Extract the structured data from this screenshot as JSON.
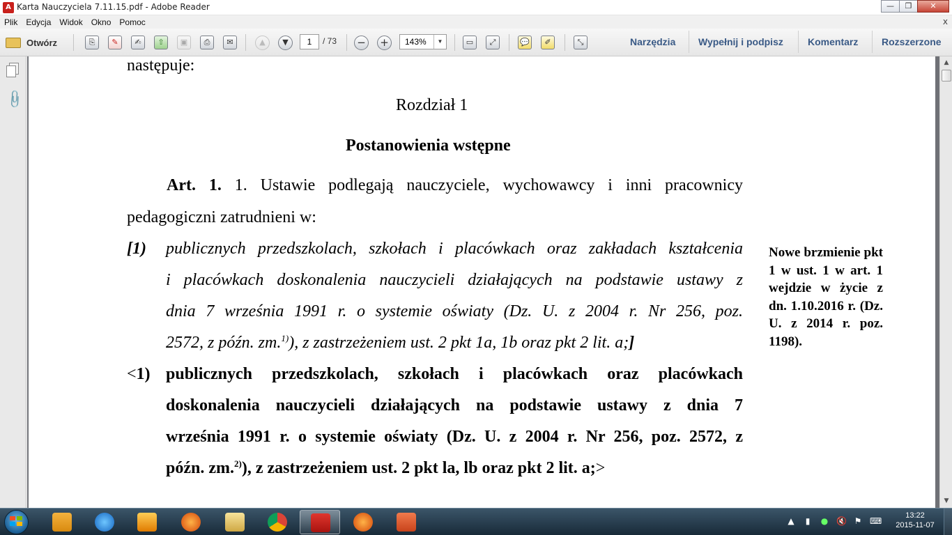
{
  "window": {
    "title": "Karta Nauczyciela 7.11.15.pdf - Adobe Reader",
    "minimize_label": "—",
    "maximize_label": "❐",
    "close_label": "✕"
  },
  "menu": {
    "items": [
      "Plik",
      "Edycja",
      "Widok",
      "Okno",
      "Pomoc"
    ],
    "close_label": "x"
  },
  "toolbar": {
    "open_label": "Otwórz",
    "page_current": "1",
    "page_total": "/ 73",
    "zoom_value": "143%",
    "zoom_dropdown": "▼",
    "right_buttons": [
      "Narzędzia",
      "Wypełnij i podpisz",
      "Komentarz",
      "Rozszerzone"
    ],
    "icons": [
      "create-pdf-icon",
      "edit-pdf-icon",
      "sign-icon",
      "upload-cloud-icon",
      "save-icon",
      "print-icon",
      "email-icon",
      "page-up-icon",
      "page-down-icon",
      "zoom-out-icon",
      "zoom-in-icon",
      "fit-page-icon",
      "fit-width-icon",
      "comment-icon",
      "highlight-icon",
      "fullscreen-icon"
    ]
  },
  "document": {
    "line_nastepuje": "następuje:",
    "chapter": "Rozdział 1",
    "chapter_title": "Postanowienia wstępne",
    "art1_label": "Art. 1.",
    "art1_line1": "1. Ustawie podlegają nauczyciele, wychowawcy i inni pracownicy",
    "art1_line2": "pedagogiczni zatrudnieni w:",
    "old_marker": "[1)",
    "old_l1": "publicznych przedszkolach, szkołach i placówkach oraz zakładach kształcenia",
    "old_l2": "i placówkach doskonalenia nauczycieli działających na podstawie ustawy z",
    "old_l3": "dnia 7 września 1991 r. o systemie oświaty (Dz. U. z 2004 r. Nr 256, poz.",
    "old_l4a": "2572, z późn. zm.",
    "old_l4_sup": "1)",
    "old_l4b": "), z zastrzeżeniem ust. 2 pkt 1a, 1b oraz pkt 2 lit. a;",
    "old_l4_close": "]",
    "new_marker_lt": "<",
    "new_marker_num": "1)",
    "new_l1": "publicznych przedszkolach, szkołach i placówkach oraz placówkach",
    "new_l2": "doskonalenia nauczycieli działających na podstawie ustawy z dnia 7",
    "new_l3": "września 1991 r. o systemie oświaty (Dz. U. z 2004 r. Nr 256, poz. 2572, z",
    "new_l4a": "późn. zm.",
    "new_l4_sup": "2)",
    "new_l4b": "), z zastrzeżeniem ust. 2 pkt la, lb oraz pkt 2 lit. a;",
    "new_l4_gt": ">",
    "side_note": "Nowe brzmienie pkt 1 w ust. 1 w art. 1 wejdzie w życie z dn. 1.10.2016 r. (Dz. U. z 2014 r. poz. 1198)."
  },
  "taskbar": {
    "apps": [
      "outlook-icon",
      "internet-explorer-icon",
      "media-player-icon",
      "firefox-icon",
      "file-explorer-icon",
      "chrome-icon",
      "adobe-reader-icon",
      "firefox-icon-2",
      "powerpoint-icon"
    ],
    "active_app": "adobe-reader-icon",
    "time": "13:22",
    "date": "2015-11-07"
  },
  "colors": {
    "accent_blue": "#3a5a86",
    "adobe_red": "#c8201c",
    "taskbar": "#203848"
  }
}
